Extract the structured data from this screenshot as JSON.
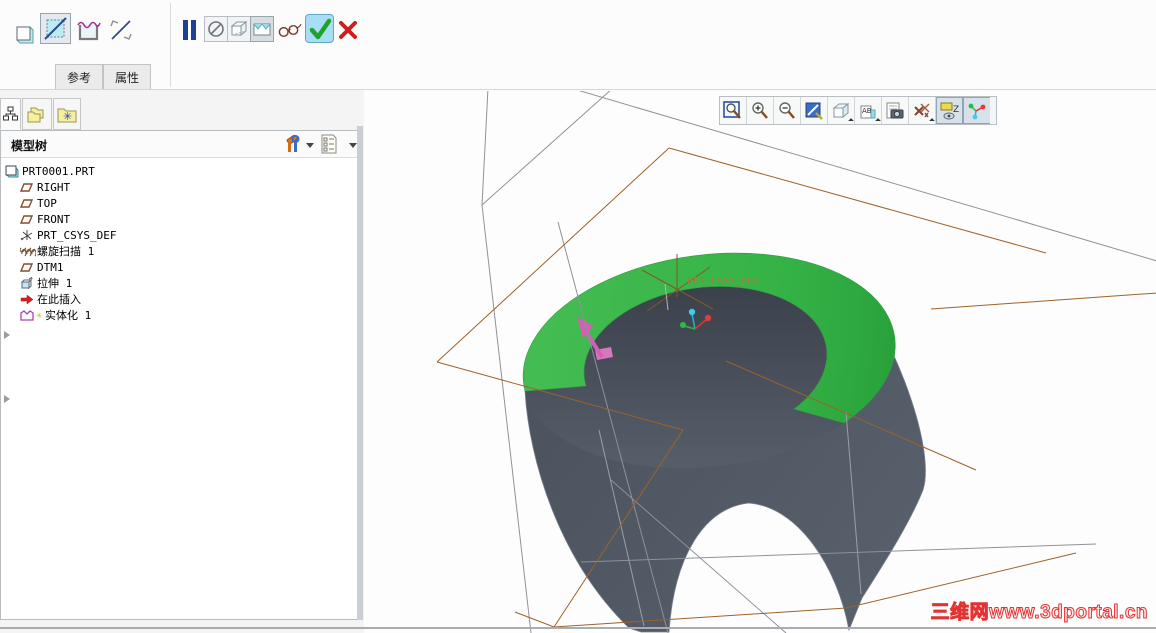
{
  "window": {
    "watermark": "三维网www.3dportal.cn"
  },
  "dashboard": {
    "left_tools": [
      {
        "name": "solid-cube"
      },
      {
        "name": "surface-hatch",
        "pressed": true
      },
      {
        "name": "quilt-trim"
      },
      {
        "name": "flip-direction"
      }
    ],
    "tabs": [
      {
        "label": "参考"
      },
      {
        "label": "属性"
      }
    ],
    "controls": [
      {
        "name": "pause"
      },
      {
        "name": "no-preview"
      },
      {
        "name": "wireframe-preview"
      },
      {
        "name": "shaded-preview",
        "pressed": true
      },
      {
        "name": "verify-glasses"
      },
      {
        "name": "accept",
        "pressed": true
      },
      {
        "name": "cancel"
      }
    ]
  },
  "model_tree": {
    "title": "模型树",
    "panel_tabs": [
      {
        "name": "model-tree-tab",
        "active": true
      },
      {
        "name": "folder-browser-tab"
      },
      {
        "name": "favorites-tab"
      }
    ],
    "header_icons": [
      {
        "name": "tree-settings-tools"
      },
      {
        "name": "tree-columns-list"
      }
    ],
    "items": [
      {
        "label": "PRT0001.PRT",
        "icon": "part",
        "indent": 0
      },
      {
        "label": "RIGHT",
        "icon": "datum-plane",
        "indent": 1
      },
      {
        "label": "TOP",
        "icon": "datum-plane",
        "indent": 1
      },
      {
        "label": "FRONT",
        "icon": "datum-plane",
        "indent": 1
      },
      {
        "label": "PRT_CSYS_DEF",
        "icon": "csys",
        "indent": 1
      },
      {
        "label": "螺旋扫描 1",
        "icon": "helical-sweep",
        "indent": 1,
        "expandable": true
      },
      {
        "label": "DTM1",
        "icon": "datum-plane",
        "indent": 1
      },
      {
        "label": "拉伸 1",
        "icon": "extrude",
        "indent": 1,
        "expandable": true
      },
      {
        "label": "在此插入",
        "icon": "insert-here",
        "indent": 1
      },
      {
        "label": "实体化 1",
        "icon": "solidify",
        "indent": 1,
        "marker": "✳"
      }
    ]
  },
  "viewport": {
    "csys_label": "PRT_CSYS_DEF",
    "toolbar": [
      {
        "name": "refit"
      },
      {
        "name": "zoom-in"
      },
      {
        "name": "zoom-out"
      },
      {
        "name": "repaint"
      },
      {
        "name": "display-style"
      },
      {
        "name": "saved-views"
      },
      {
        "name": "snapshot"
      },
      {
        "name": "datum-display"
      },
      {
        "name": "annotation-display",
        "pressed": true
      },
      {
        "name": "spin-center",
        "pressed": true
      }
    ]
  },
  "colors": {
    "surface_green": "#3bb54a",
    "body_gray": "#4e5560",
    "datum_brown": "#9c6329",
    "datum_gray": "#8f9296",
    "arrow_pink": "#d45fb4",
    "accept_blue": "#a8ddf4",
    "watermark_red": "#e23333"
  }
}
